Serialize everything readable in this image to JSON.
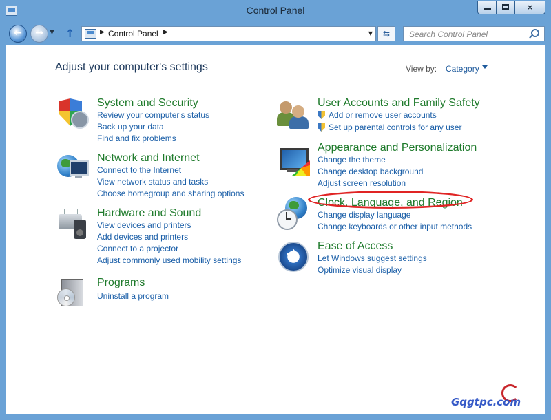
{
  "window": {
    "title": "Control Panel",
    "controls": {
      "close": "×"
    }
  },
  "nav": {
    "address": "Control Panel",
    "search_placeholder": "Search Control Panel"
  },
  "main": {
    "heading": "Adjust your computer's settings",
    "view_by_label": "View by:",
    "view_by_value": "Category"
  },
  "categories": [
    {
      "title": "System and Security",
      "links": [
        "Review your computer's status",
        "Back up your data",
        "Find and fix problems"
      ]
    },
    {
      "title": "Network and Internet",
      "links": [
        "Connect to the Internet",
        "View network status and tasks",
        "Choose homegroup and sharing options"
      ]
    },
    {
      "title": "Hardware and Sound",
      "links": [
        "View devices and printers",
        "Add devices and printers",
        "Connect to a projector",
        "Adjust commonly used mobility settings"
      ]
    },
    {
      "title": "Programs",
      "links": [
        "Uninstall a program"
      ]
    },
    {
      "title": "User Accounts and Family Safety",
      "links": [
        "Add or remove user accounts",
        "Set up parental controls for any user"
      ]
    },
    {
      "title": "Appearance and Personalization",
      "links": [
        "Change the theme",
        "Change desktop background",
        "Adjust screen resolution"
      ]
    },
    {
      "title": "Clock, Language, and Region",
      "links": [
        "Change display language",
        "Change keyboards or other input methods"
      ]
    },
    {
      "title": "Ease of Access",
      "links": [
        "Let Windows suggest settings",
        "Optimize visual display"
      ]
    }
  ],
  "annotation": {
    "color": "#e02424"
  },
  "watermark": {
    "text": "Gqgtpc.com"
  }
}
